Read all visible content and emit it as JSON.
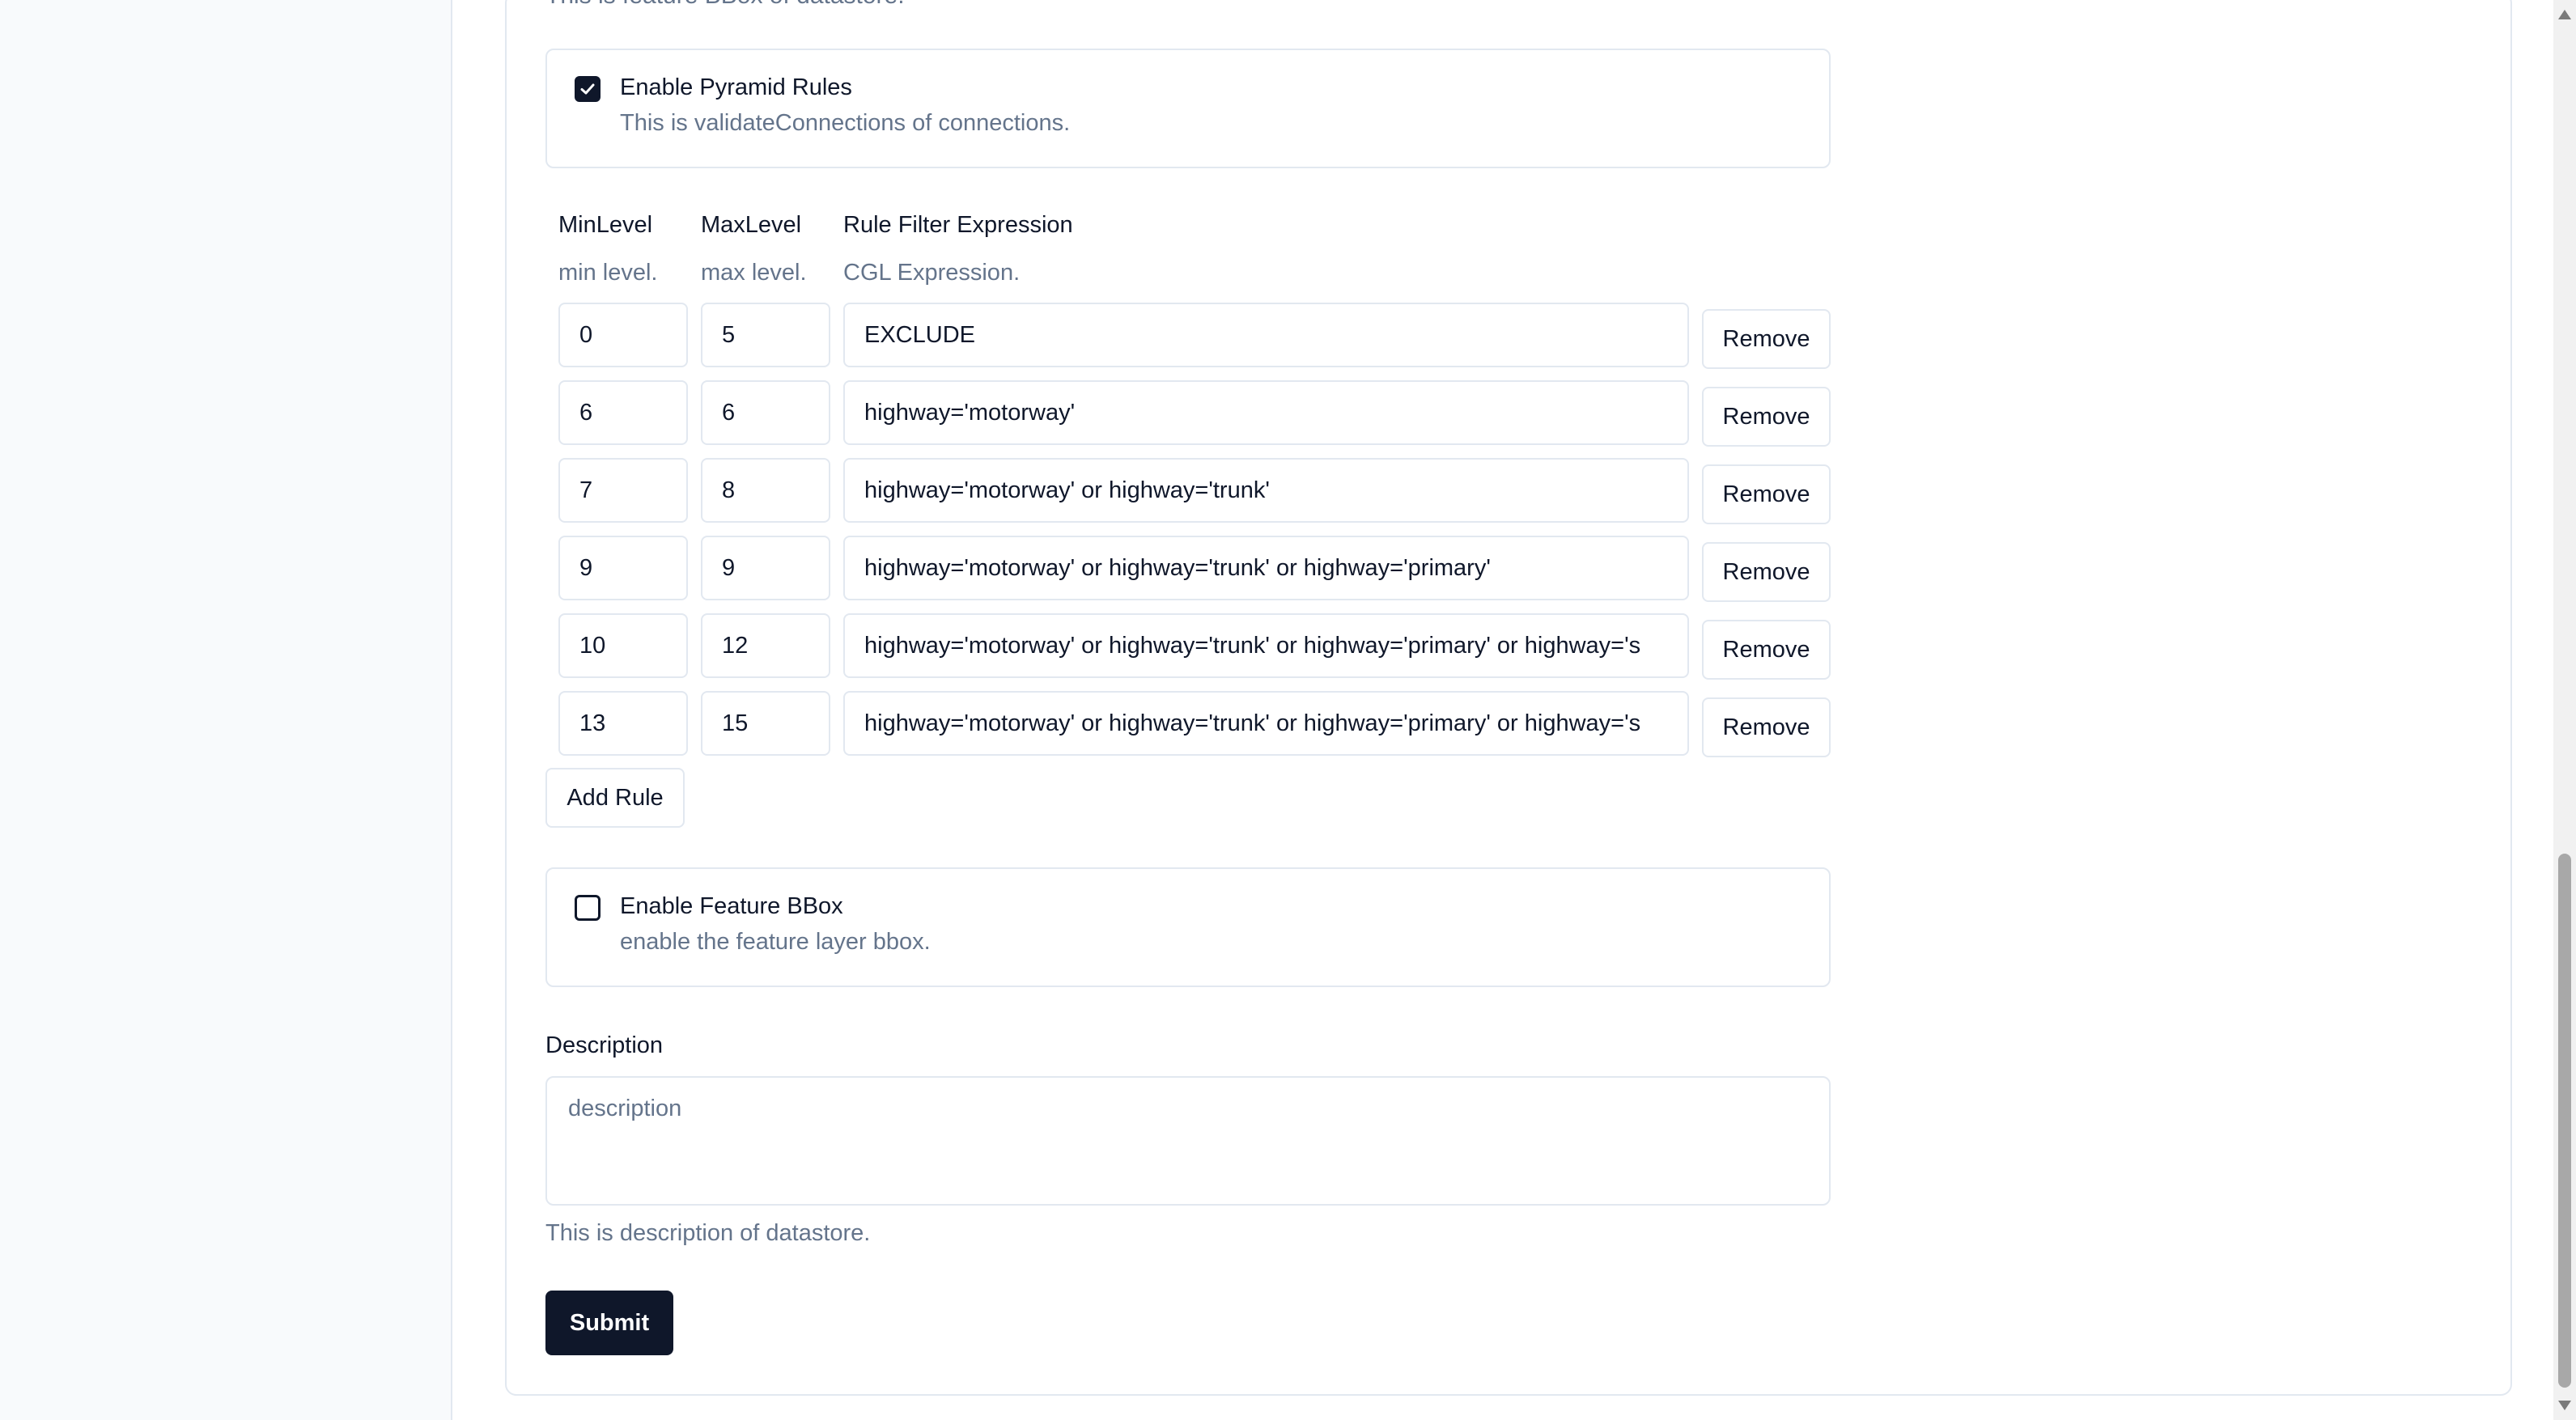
{
  "clipped_heading": "This is feature BBox of datastore.",
  "pyramid_rules": {
    "title": "Enable Pyramid Rules",
    "description": "This is validateConnections of connections.",
    "checked": true
  },
  "rules_table": {
    "columns": [
      {
        "header": "MinLevel",
        "description": "min level."
      },
      {
        "header": "MaxLevel",
        "description": "max level."
      },
      {
        "header": "Rule Filter Expression",
        "description": "CGL Expression."
      }
    ],
    "rows": [
      {
        "min": "0",
        "max": "5",
        "expression": "EXCLUDE",
        "remove_label": "Remove"
      },
      {
        "min": "6",
        "max": "6",
        "expression": "highway='motorway'",
        "remove_label": "Remove"
      },
      {
        "min": "7",
        "max": "8",
        "expression": "highway='motorway' or highway='trunk'",
        "remove_label": "Remove"
      },
      {
        "min": "9",
        "max": "9",
        "expression": "highway='motorway' or highway='trunk' or highway='primary'",
        "remove_label": "Remove"
      },
      {
        "min": "10",
        "max": "12",
        "expression": "highway='motorway' or highway='trunk' or highway='primary' or highway='s",
        "remove_label": "Remove"
      },
      {
        "min": "13",
        "max": "15",
        "expression": "highway='motorway' or highway='trunk' or highway='primary' or highway='s",
        "remove_label": "Remove"
      }
    ],
    "add_rule_label": "Add Rule"
  },
  "feature_bbox": {
    "title": "Enable Feature BBox",
    "description": "enable the feature layer bbox.",
    "checked": false
  },
  "description_field": {
    "label": "Description",
    "placeholder": "description",
    "help": "This is description of datastore."
  },
  "submit_label": "Submit"
}
